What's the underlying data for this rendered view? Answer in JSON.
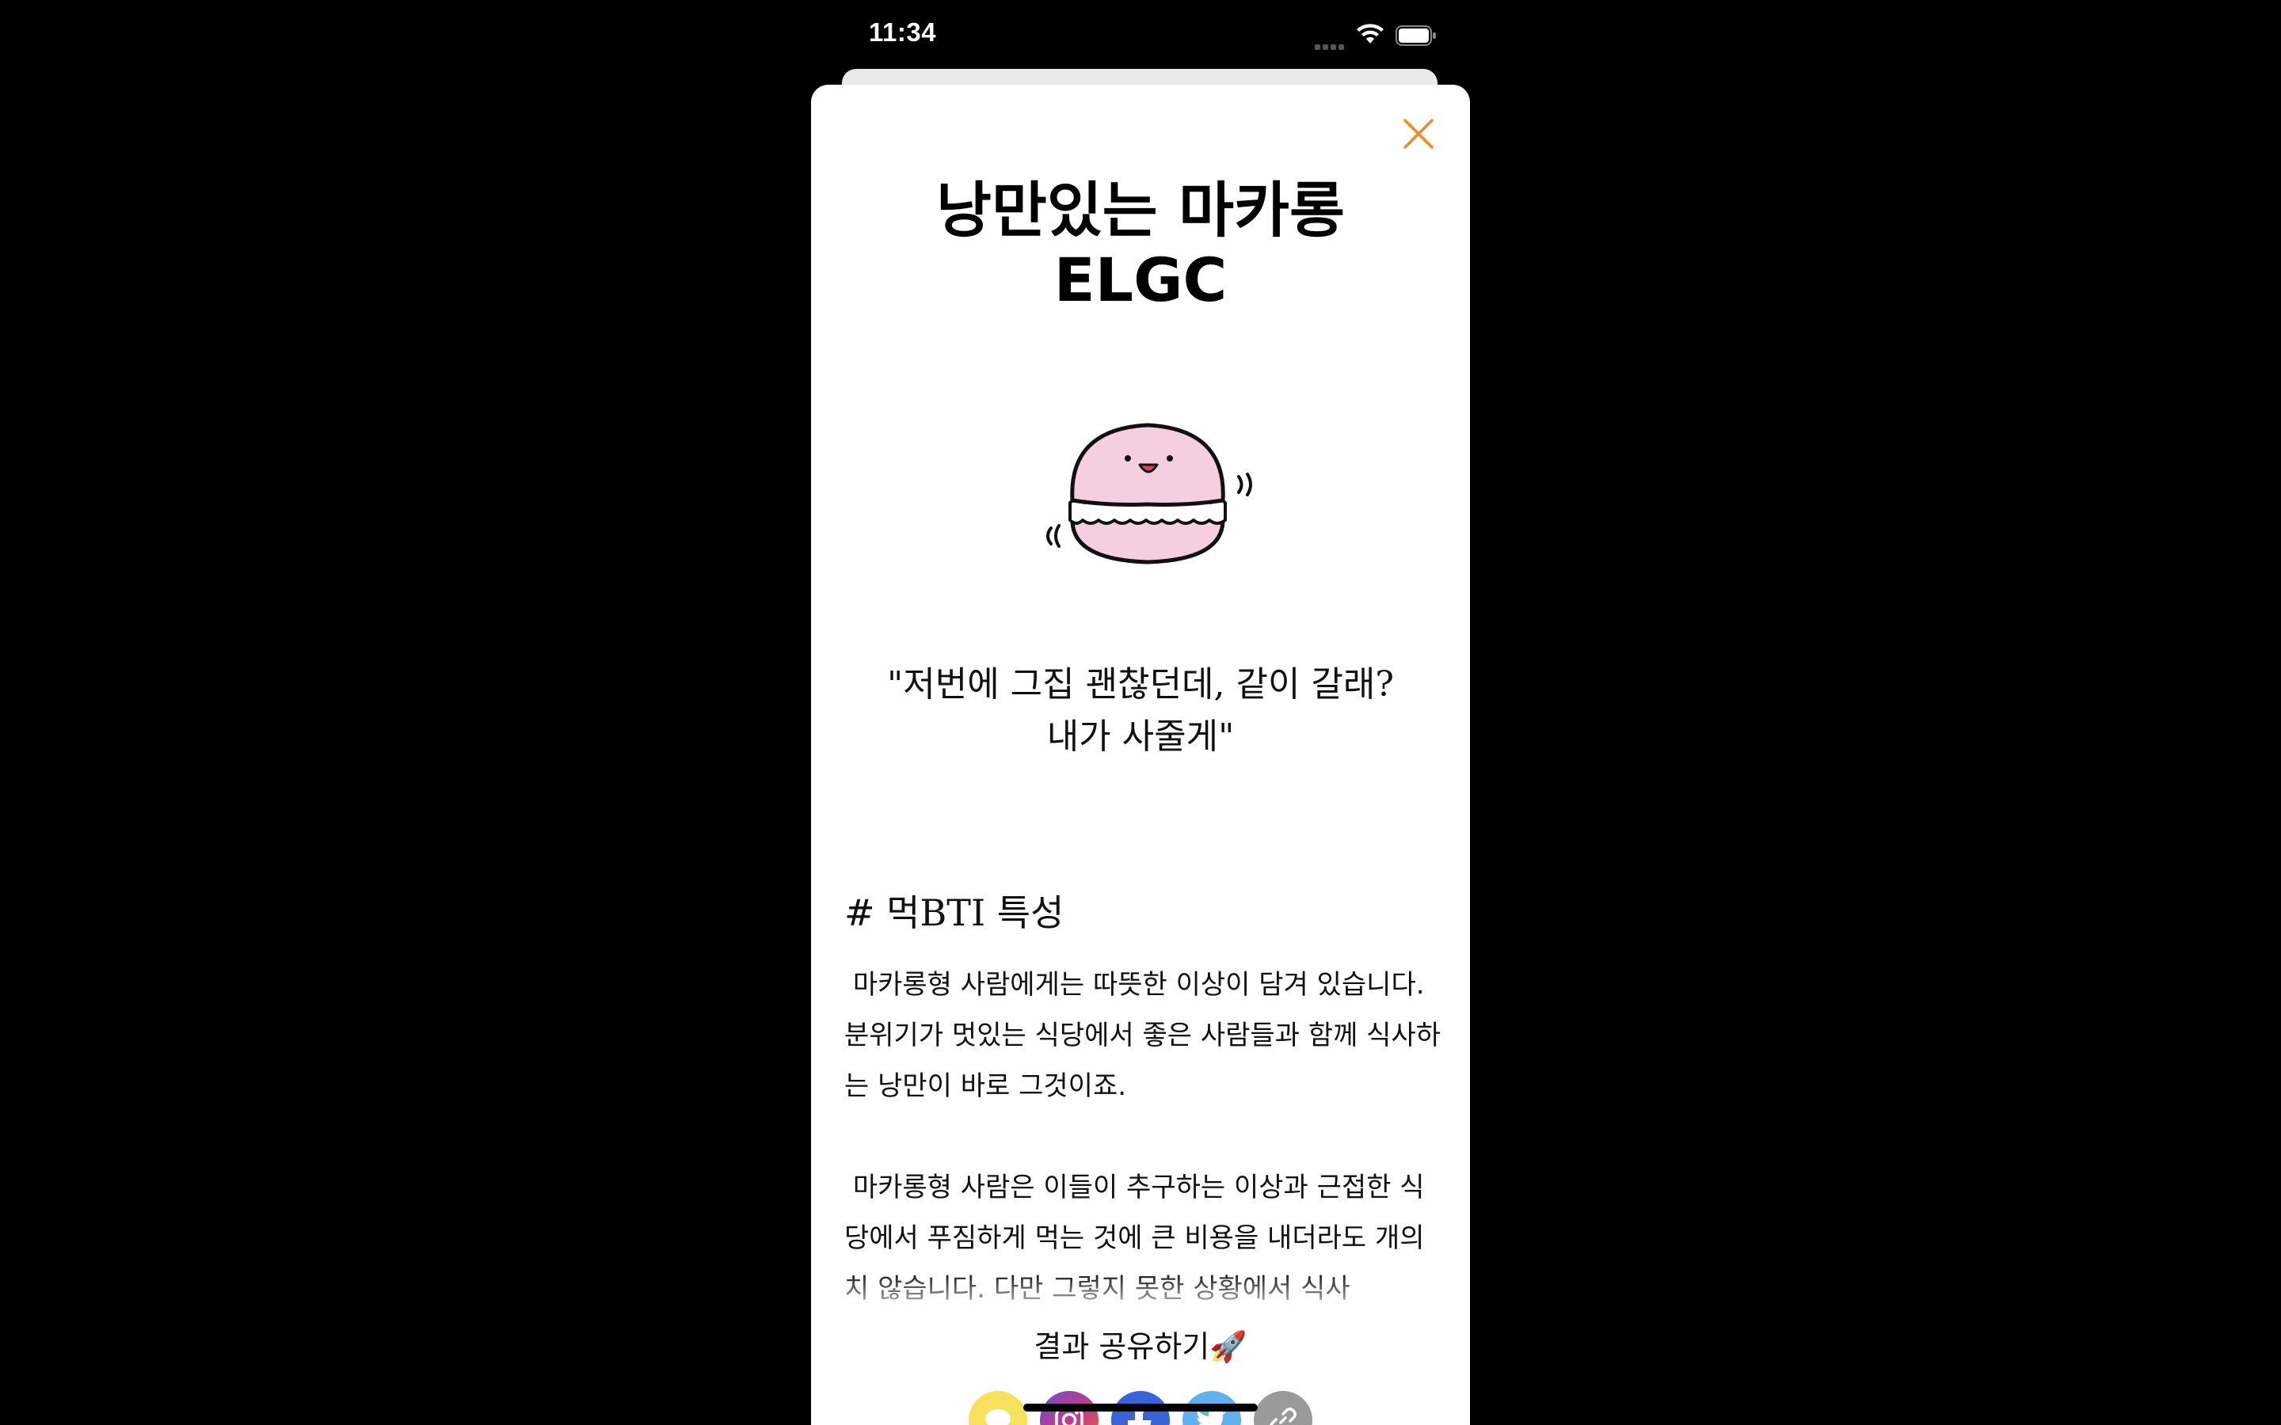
{
  "status_bar": {
    "time": "11:34"
  },
  "result": {
    "title_line1": "낭만있는 마카롱",
    "title_line2": "ELGC",
    "image": "macaron-illustration",
    "quote_line1": "\"저번에 그집 괜찮던데, 같이 갈래?",
    "quote_line2": "내가 사줄게\"",
    "section_title": "# 먹BTI 특성",
    "paragraph1": " 마카롱형 사람에게는 따뜻한 이상이 담겨 있습니다. 분위기가 멋있는 식당에서 좋은 사람들과 함께 식사하는 낭만이 바로 그것이죠.",
    "paragraph2": " 마카롱형 사람은 이들이 추구하는 이상과 근접한 식당에서 푸짐하게 먹는 것에 큰 비용을 내더라도 개의치 않습니다. 다만 그렇지 못한 상황에서 식사"
  },
  "share": {
    "label": "결과 공유하기🚀",
    "buttons": [
      {
        "name": "kakao",
        "icon": "chat-bubble-icon",
        "color": "#f5e15c"
      },
      {
        "name": "instagram",
        "icon": "instagram-icon",
        "color": "#c43b8a"
      },
      {
        "name": "facebook",
        "icon": "facebook-icon",
        "color": "#3b63d9"
      },
      {
        "name": "twitter",
        "icon": "twitter-bird-icon",
        "color": "#5fb2ee"
      },
      {
        "name": "copy-link",
        "icon": "link-icon",
        "color": "#9a9a9a"
      }
    ]
  },
  "colors": {
    "close_icon": "#f08c1e",
    "macaron_fill": "#f5cfe0"
  }
}
